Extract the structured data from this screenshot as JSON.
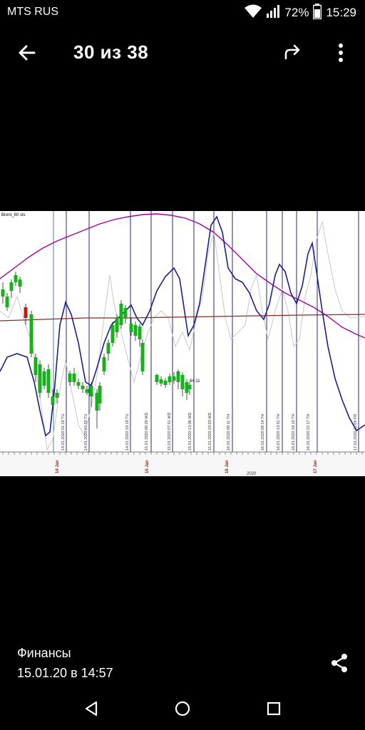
{
  "status": {
    "carrier": "MTS RUS",
    "battery": "72%",
    "time": "15:29",
    "icons": [
      "wifi-icon",
      "signal-icon",
      "battery-icon"
    ]
  },
  "viewer": {
    "counter": "30 из 38",
    "icons": [
      "back-arrow-icon",
      "share-forward-icon",
      "more-vert-icon"
    ]
  },
  "photo": {
    "symbol_label": "Brent_60 sts",
    "price_label": "64.11",
    "year_label": "2020",
    "date_labels": [
      "14 Jan",
      "15 Jan",
      "16 Jan",
      "17 Jan"
    ],
    "time_labels": [
      "14.01.2020 01:18 TU",
      "14.01.2020 07:50 TU",
      "14.01.2020 19:18 TU",
      "15.01.2020 00:20 WD",
      "15.01.2020 07:51 WD",
      "15.01.2020 13:06 WD",
      "15.01.2020 19:03 WD",
      "16.01.2020 00:11 TH",
      "16.01.2020 09:14 TH",
      "16.01.2020 13:51 TH",
      "16.01.2020 18:10 TH",
      "16.01.2020 22:17 TH",
      "17.01.2020 11:09 FR"
    ],
    "colors": {
      "purple": "#a100a1",
      "navy": "#1b1f86",
      "brown": "#8b2a1f",
      "bull": "#17b11c",
      "bear": "#c81818"
    }
  },
  "footer": {
    "album": "Финансы",
    "date": "15.01.20 в 14:57",
    "icons": [
      "share-icon"
    ]
  },
  "navbar": {
    "icons": [
      "nav-back-icon",
      "nav-home-icon",
      "nav-recents-icon"
    ]
  }
}
